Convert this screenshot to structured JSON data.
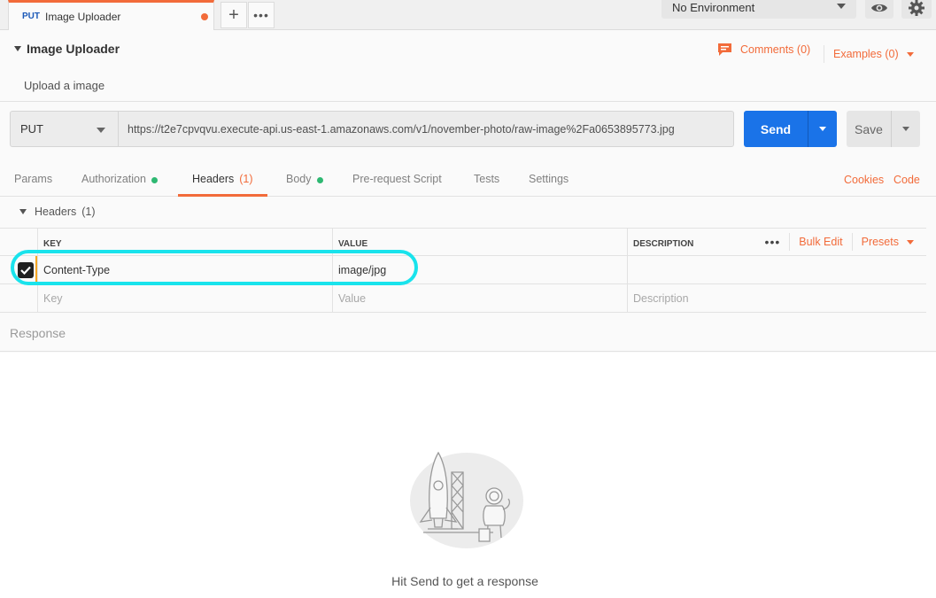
{
  "tab": {
    "method": "PUT",
    "title": "Image Uploader",
    "add_icon": "plus-icon",
    "more_icon": "more-dots-icon"
  },
  "environment": {
    "selected": "No Environment",
    "eye_icon": "eye-icon",
    "gear_icon": "gear-icon"
  },
  "request": {
    "title": "Image Uploader",
    "description": "Upload a image",
    "comments_label": "Comments (0)",
    "examples_label": "Examples (0)"
  },
  "url_bar": {
    "method": "PUT",
    "url": "https://t2e7cpvqvu.execute-api.us-east-1.amazonaws.com/v1/november-photo/raw-image%2Fa0653895773.jpg",
    "send_label": "Send",
    "save_label": "Save"
  },
  "subtabs": [
    {
      "label": "Params"
    },
    {
      "label": "Authorization"
    },
    {
      "label": "Headers",
      "count": "(1)"
    },
    {
      "label": "Body"
    },
    {
      "label": "Pre-request Script"
    },
    {
      "label": "Tests"
    },
    {
      "label": "Settings"
    }
  ],
  "links": {
    "cookies": "Cookies",
    "code": "Code"
  },
  "headers_section": {
    "title": "Headers",
    "count": "(1)",
    "columns": {
      "key": "KEY",
      "value": "VALUE",
      "description": "DESCRIPTION"
    },
    "bulk_edit": "Bulk Edit",
    "presets": "Presets",
    "rows": [
      {
        "checked": true,
        "key": "Content-Type",
        "value": "image/jpg",
        "description": ""
      }
    ],
    "placeholders": {
      "key": "Key",
      "value": "Value",
      "description": "Description"
    }
  },
  "response": {
    "label": "Response",
    "empty_message": "Hit Send to get a response"
  },
  "colors": {
    "accent": "#f26b3a",
    "send": "#1a73e8",
    "highlight": "#19e3ec",
    "dot": "#2eb872"
  }
}
